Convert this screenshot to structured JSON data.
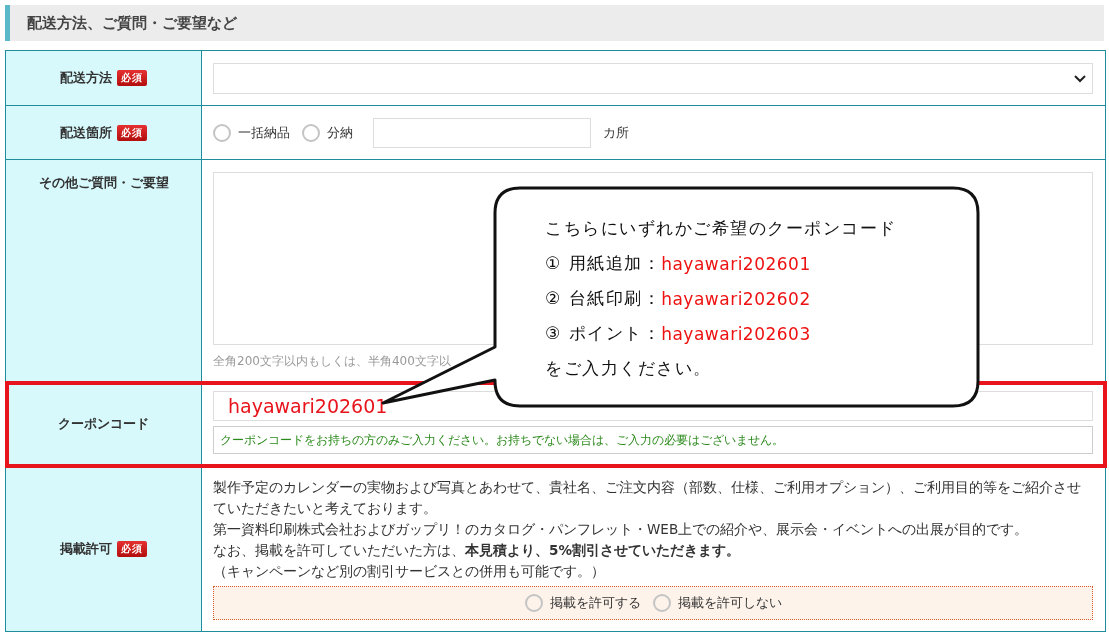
{
  "section_title": "配送方法、ご質問・ご要望など",
  "rows": [
    {
      "kind": "select",
      "label": "配送方法",
      "required_badge": "必須"
    },
    {
      "kind": "delivery",
      "label": "配送箇所",
      "required_badge": "必須",
      "options": [
        {
          "label": "一括納品",
          "selected": false
        },
        {
          "label": "分納",
          "selected": false
        }
      ],
      "unit": "カ所"
    },
    {
      "kind": "textarea",
      "label": "その他ご質問・ご要望",
      "hint": "全角200文字以内もしくは、半角400文字以"
    },
    {
      "kind": "coupon",
      "label": "クーポンコード",
      "highlighted": true,
      "value": "hayawari202601",
      "note": "クーポンコードをお持ちの方のみご入力ください。お持ちでない場合は、ご入力の必要はございません。"
    },
    {
      "kind": "permission",
      "label": "掲載許可",
      "required_badge": "必須",
      "paragraphs": [
        "製作予定のカレンダーの実物および写真とあわせて、貴社名、ご注文内容（部数、仕様、ご利用オプション）、ご利用目的等をご紹介させていただきたいと考えております。",
        "第一資料印刷株式会社およびガップリ！のカタログ・パンフレット・WEB上での紹介や、展示会・イベントへの出展が目的です。",
        "なお、掲載を許可していただいた方は、**本見積より、5%割引させていただきます。**",
        "（キャンペーンなど別の割引サービスとの併用も可能です。）"
      ],
      "options": [
        {
          "label": "掲載を許可する",
          "selected": false
        },
        {
          "label": "掲載を許可しない",
          "selected": false
        }
      ]
    }
  ],
  "callout": {
    "heading": "こちらにいずれかご希望のクーポンコード",
    "items": [
      {
        "label": "① 用紙追加：",
        "code": "hayawari202601"
      },
      {
        "label": "② 台紙印刷：",
        "code": "hayawari202602"
      },
      {
        "label": "③ ポイント：",
        "code": "hayawari202603"
      }
    ],
    "footer": "をご入力ください。"
  }
}
